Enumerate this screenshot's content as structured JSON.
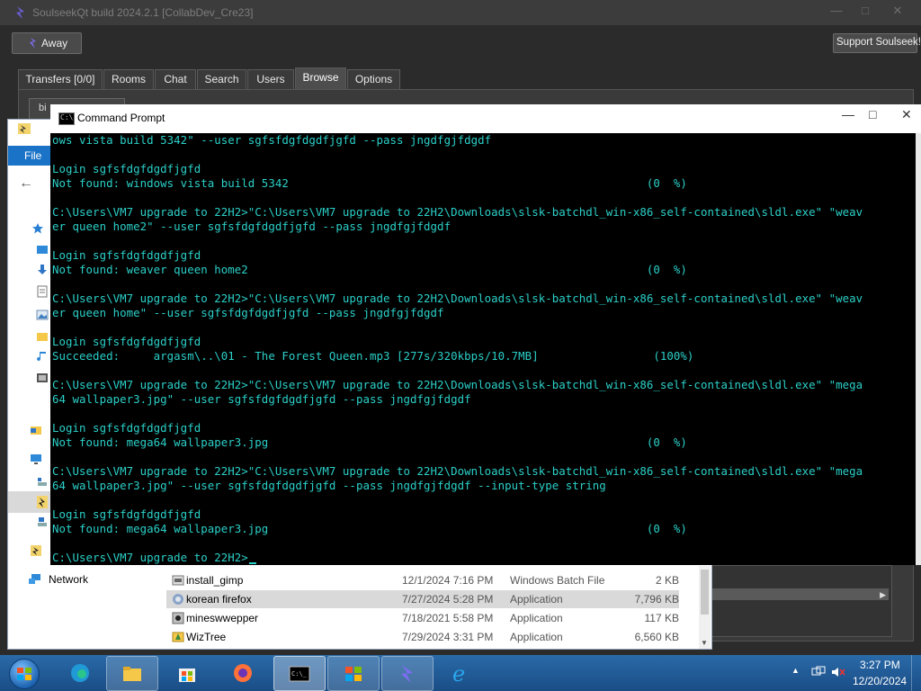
{
  "soulseek": {
    "title": "SoulseekQt build 2024.2.1 [CollabDev_Cre23]",
    "away_label": "Away",
    "support_label": "Support Soulseek!",
    "tabs": [
      {
        "label": "Transfers [0/0]"
      },
      {
        "label": "Rooms"
      },
      {
        "label": "Chat"
      },
      {
        "label": "Search"
      },
      {
        "label": "Users"
      },
      {
        "label": "Browse"
      },
      {
        "label": "Options"
      }
    ],
    "active_tab": "Browse",
    "subtab_label": "bi"
  },
  "explorer": {
    "file_label": "File",
    "network_label": "Network",
    "files": [
      {
        "name": "install_gimp",
        "date": "12/1/2024 7:16 PM",
        "type": "Windows Batch File",
        "size": "2 KB"
      },
      {
        "name": "korean firefox",
        "date": "7/27/2024 5:28 PM",
        "type": "Application",
        "size": "7,796 KB"
      },
      {
        "name": "mineswwepper",
        "date": "7/18/2021 5:58 PM",
        "type": "Application",
        "size": "117 KB"
      },
      {
        "name": "WizTree",
        "date": "7/29/2024 3:31 PM",
        "type": "Application",
        "size": "6,560 KB"
      }
    ]
  },
  "cmd": {
    "title": "Command Prompt",
    "lines": [
      "ows vista build 5342\" --user sgfsfdgfdgdfjgfd --pass jngdfgjfdgdf",
      "",
      "Login sgfsfdgfdgdfjgfd",
      "Not found: windows vista build 5342                                                     (0  %)",
      "",
      "C:\\Users\\VM7 upgrade to 22H2>\"C:\\Users\\VM7 upgrade to 22H2\\Downloads\\slsk-batchdl_win-x86_self-contained\\sldl.exe\" \"weav",
      "er queen home2\" --user sgfsfdgfdgdfjgfd --pass jngdfgjfdgdf",
      "",
      "Login sgfsfdgfdgdfjgfd",
      "Not found: weaver queen home2                                                           (0  %)",
      "",
      "C:\\Users\\VM7 upgrade to 22H2>\"C:\\Users\\VM7 upgrade to 22H2\\Downloads\\slsk-batchdl_win-x86_self-contained\\sldl.exe\" \"weav",
      "er queen home\" --user sgfsfdgfdgdfjgfd --pass jngdfgjfdgdf",
      "",
      "Login sgfsfdgfdgdfjgfd",
      "Succeeded:     argasm\\..\\01 - The Forest Queen.mp3 [277s/320kbps/10.7MB]                 (100%)",
      "",
      "C:\\Users\\VM7 upgrade to 22H2>\"C:\\Users\\VM7 upgrade to 22H2\\Downloads\\slsk-batchdl_win-x86_self-contained\\sldl.exe\" \"mega",
      "64 wallpaper3.jpg\" --user sgfsfdgfdgdfjgfd --pass jngdfgjfdgdf",
      "",
      "Login sgfsfdgfdgdfjgfd",
      "Not found: mega64 wallpaper3.jpg                                                        (0  %)",
      "",
      "C:\\Users\\VM7 upgrade to 22H2>\"C:\\Users\\VM7 upgrade to 22H2\\Downloads\\slsk-batchdl_win-x86_self-contained\\sldl.exe\" \"mega",
      "64 wallpaper3.jpg\" --user sgfsfdgfdgdfjgfd --pass jngdfgjfdgdf --input-type string",
      "",
      "Login sgfsfdgfdgdfjgfd",
      "Not found: mega64 wallpaper3.jpg                                                        (0  %)",
      "",
      "C:\\Users\\VM7 upgrade to 22H2>"
    ]
  },
  "taskbar": {
    "items": [
      {
        "icon": "edge-icon"
      },
      {
        "icon": "file-explorer-icon"
      },
      {
        "icon": "store-icon"
      },
      {
        "icon": "firefox-icon"
      },
      {
        "icon": "command-prompt-icon"
      },
      {
        "icon": "windows-flag-icon"
      },
      {
        "icon": "soulseek-icon"
      },
      {
        "icon": "internet-explorer-icon"
      }
    ],
    "clock_time": "3:27 PM",
    "clock_date": "12/20/2024"
  },
  "colors": {
    "console_text": "#2bd0c8",
    "console_bg": "#000000",
    "taskbar": "#1f5a96",
    "soulseek_bg": "#2b2b2b"
  }
}
